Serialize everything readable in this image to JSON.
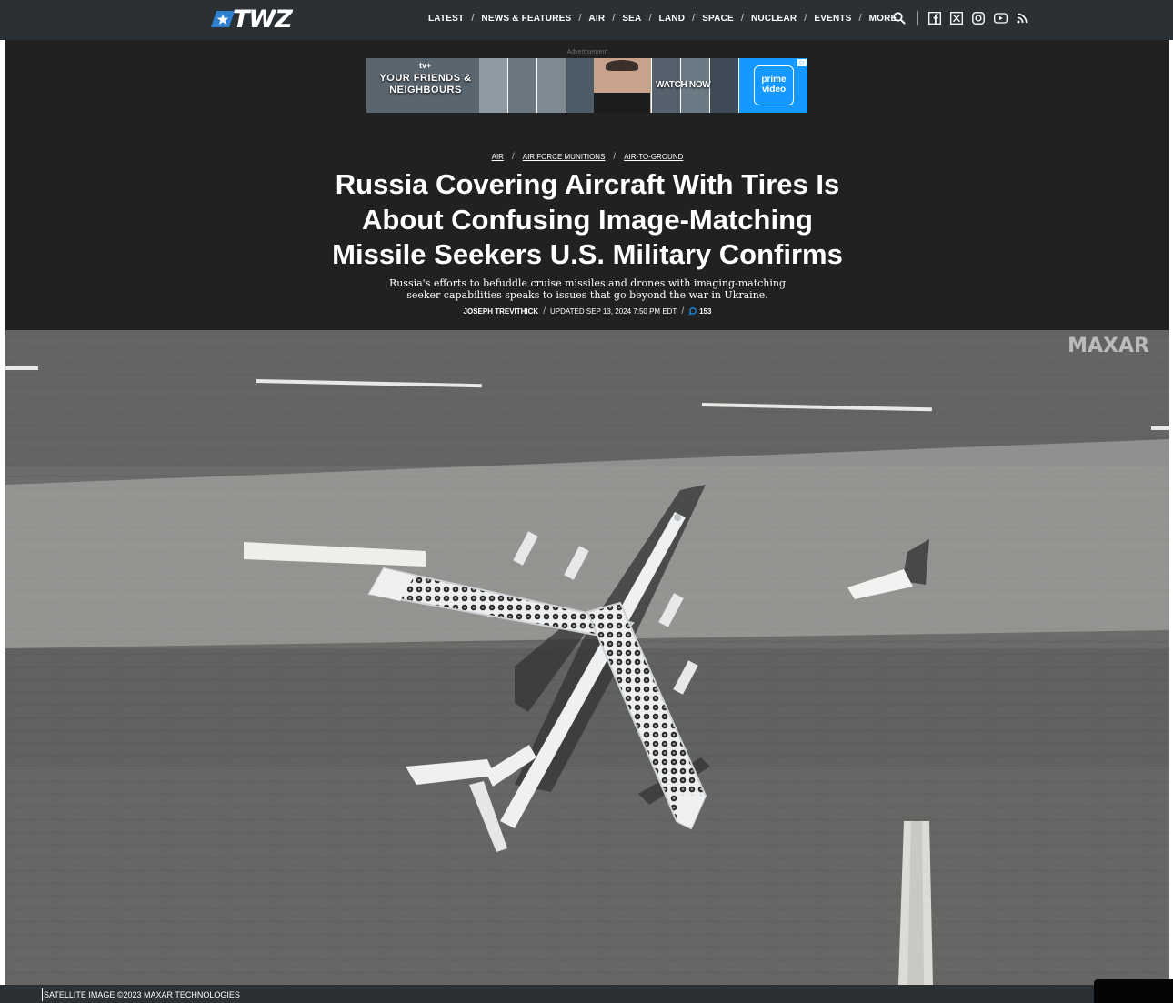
{
  "site": {
    "logo_text": "TWZ"
  },
  "nav": {
    "links": [
      "LATEST",
      "NEWS & FEATURES",
      "AIR",
      "SEA",
      "LAND",
      "SPACE",
      "NUCLEAR",
      "EVENTS",
      "MORE"
    ],
    "icons": [
      "search-icon",
      "facebook-icon",
      "x-icon",
      "instagram-icon",
      "youtube-icon",
      "rss-icon"
    ]
  },
  "ad": {
    "label": "Advertisement",
    "tv_brand": "tv+",
    "title": "YOUR FRIENDS & NEIGHBOURS",
    "cta": "WATCH NOW",
    "partner": "prime video"
  },
  "article": {
    "categories": [
      "AIR",
      "AIR FORCE MUNITIONS",
      "AIR-TO-GROUND"
    ],
    "headline_lines": [
      "Russia Covering Aircraft With Tires Is",
      "About Confusing Image-Matching",
      "Missile Seekers U.S. Military Confirms"
    ],
    "dek_lines": [
      "Russia's efforts to befuddle cruise missiles and drones with imaging-matching",
      "seeker capabilities speaks to issues that go beyond the war in Ukraine."
    ],
    "author": "JOSEPH TREVITHICK",
    "updated": "UPDATED SEP 13, 2024 7:50 PM EDT",
    "comments": "153"
  },
  "photo": {
    "watermark": "MAXAR",
    "caption": "SATELLITE IMAGE ©2023 MAXAR TECHNOLOGIES"
  },
  "colors": {
    "nav_bg": "#2b3035",
    "hero_bg": "#212121",
    "logo_blue": "#2e7fd0",
    "accent_blue": "#1399ff"
  }
}
